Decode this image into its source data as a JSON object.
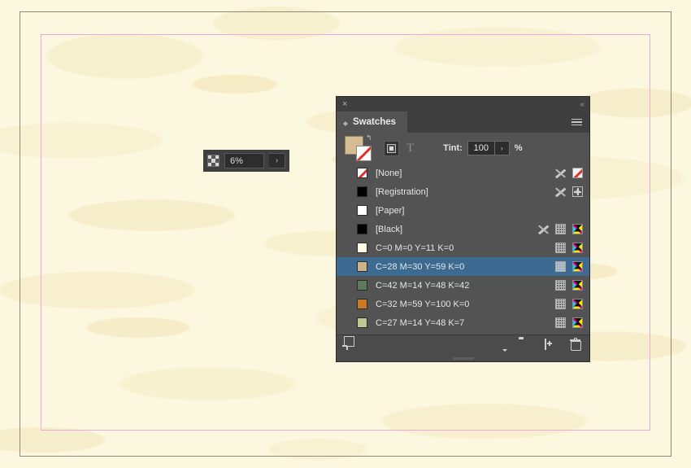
{
  "canvas": {
    "background_color": "#fcf8e0",
    "doc_edge_color": "#8d8a79",
    "margin_guide_color": "#efa8df"
  },
  "zoom_widget": {
    "icon": "grid-icon",
    "value": "6%",
    "stepper_label": "›"
  },
  "panel": {
    "close_label": "×",
    "collapse_label": "«",
    "tab_label": "Swatches",
    "menu_icon": "panel-menu-icon",
    "options": {
      "fill_color": "#d6bd91",
      "stroke_color": "none",
      "swap_label": "↰",
      "affect_container_icon": "formatting-affects-container-icon",
      "affect_text_label": "T",
      "tint_label": "Tint:",
      "tint_value": "100",
      "tint_stepper_label": "›",
      "tint_unit": "%"
    },
    "swatches": [
      {
        "name": "[None]",
        "color": "none",
        "selected": false,
        "icons": [
          "pencil-x",
          "none-indicator"
        ]
      },
      {
        "name": "[Registration]",
        "color": "#000000",
        "selected": false,
        "icons": [
          "pencil-x",
          "registration-indicator"
        ]
      },
      {
        "name": "[Paper]",
        "color": "#ffffff",
        "selected": false,
        "icons": []
      },
      {
        "name": "[Black]",
        "color": "#000000",
        "selected": false,
        "icons": [
          "pencil-x",
          "dot-indicator",
          "cmyk-indicator"
        ]
      },
      {
        "name": "C=0 M=0 Y=11 K=0",
        "color": "#fdfae6",
        "selected": false,
        "icons": [
          "dot-indicator",
          "cmyk-indicator"
        ]
      },
      {
        "name": "C=28 M=30 Y=59 K=0",
        "color": "#cdb388",
        "selected": true,
        "icons": [
          "dot-indicator",
          "cmyk-indicator"
        ]
      },
      {
        "name": "C=42 M=14 Y=48 K=42",
        "color": "#5e7a5e",
        "selected": false,
        "icons": [
          "dot-indicator",
          "cmyk-indicator"
        ]
      },
      {
        "name": "C=32 M=59 Y=100 K=0",
        "color": "#cc7a20",
        "selected": false,
        "icons": [
          "dot-indicator",
          "cmyk-indicator"
        ]
      },
      {
        "name": "C=27 M=14 Y=48 K=7",
        "color": "#bcc795",
        "selected": false,
        "icons": [
          "dot-indicator",
          "cmyk-indicator"
        ]
      }
    ],
    "footer": {
      "library_icon": "add-to-library-icon",
      "color_group_icon": "show-color-groups-icon",
      "folder_icon": "new-color-group-icon",
      "new_swatch_icon": "new-swatch-icon",
      "delete_icon": "delete-swatch-icon"
    },
    "selection_color": "#3d6a91"
  }
}
